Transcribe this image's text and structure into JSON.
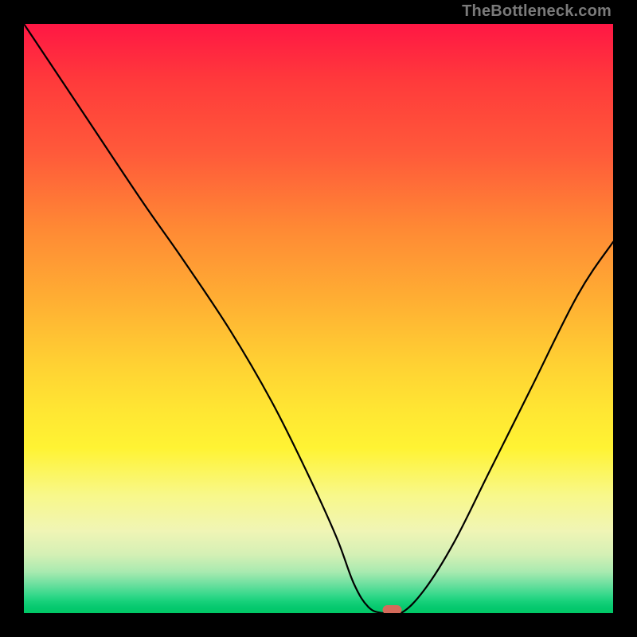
{
  "attribution": "TheBottleneck.com",
  "colors": {
    "frame": "#000000",
    "gradient_top": "#ff1744",
    "gradient_bottom": "#00c765",
    "curve_stroke": "#000000",
    "marker_fill": "#d46a5a",
    "attribution_text": "#7a7a7a"
  },
  "chart_data": {
    "type": "line",
    "title": "",
    "xlabel": "",
    "ylabel": "",
    "xlim": [
      0,
      100
    ],
    "ylim": [
      0,
      100
    ],
    "series": [
      {
        "name": "bottleneck-curve",
        "x": [
          0,
          10,
          20,
          27,
          35,
          42,
          48,
          53,
          56,
          58.5,
          61,
          64,
          68,
          73,
          79,
          86,
          94,
          100
        ],
        "values": [
          100,
          85,
          70,
          60,
          48,
          36,
          24,
          13,
          5,
          1,
          0,
          0,
          4,
          12,
          24,
          38,
          54,
          63
        ]
      }
    ],
    "annotations": [
      {
        "name": "min-marker",
        "x": 62.5,
        "y": 0
      }
    ]
  }
}
